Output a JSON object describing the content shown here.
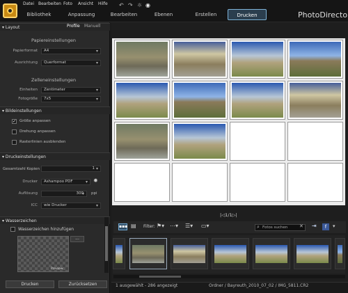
{
  "menu": [
    "Datei",
    "Bearbeiten",
    "Foto",
    "Ansicht",
    "Hilfe"
  ],
  "tabs": [
    "Bibliothek",
    "Anpassung",
    "Bearbeiten",
    "Ebenen",
    "Erstellen",
    "Drucken"
  ],
  "brand": "PhotoDirector",
  "left": {
    "layout": {
      "title": "Layout",
      "tab_profile": "Profile",
      "tab_manual": "Manuell"
    },
    "paper": {
      "title": "Papiereinstellungen",
      "format_label": "Papierformat",
      "format_value": "A4",
      "orientation_label": "Ausrichtung",
      "orientation_value": "Querformat"
    },
    "cells": {
      "title": "Zelleneinstellungen",
      "units_label": "Einheiten",
      "units_value": "Zentimeter",
      "photosize_label": "Fotogröße",
      "photosize_value": "7x5"
    },
    "image": {
      "title": "Bildeinstellungen",
      "opt1": "Größe anpassen",
      "opt2": "Drehung anpassen",
      "opt3": "Rasterlinien ausblenden"
    },
    "print": {
      "title": "Druckeinstellungen",
      "copies_label": "Gesamtzahl Kopien",
      "copies_value": "1",
      "printer_label": "Drucker",
      "printer_value": "Ashampoo PDF",
      "res_label": "Auflösung",
      "res_value": "300",
      "res_unit": "ppi",
      "icc_label": "ICC",
      "icc_value": "wie Drucker"
    },
    "watermark": {
      "title": "Wasserzeichen",
      "add_label": "Wasserzeichen hinzufügen",
      "preview_text": "Preview",
      "more": "..."
    },
    "buttons": {
      "print": "Drucken",
      "reset": "Zurücksetzen"
    }
  },
  "pager": "|◁1/1▷|",
  "filter": {
    "label": "Filter:",
    "search_placeholder": "Fotos suchen"
  },
  "status": {
    "left": "1 ausgewählt - 286 angezeigt",
    "right": "Ordner / Bayreuth_2010_07_02 / IMG_5811.CR2"
  }
}
